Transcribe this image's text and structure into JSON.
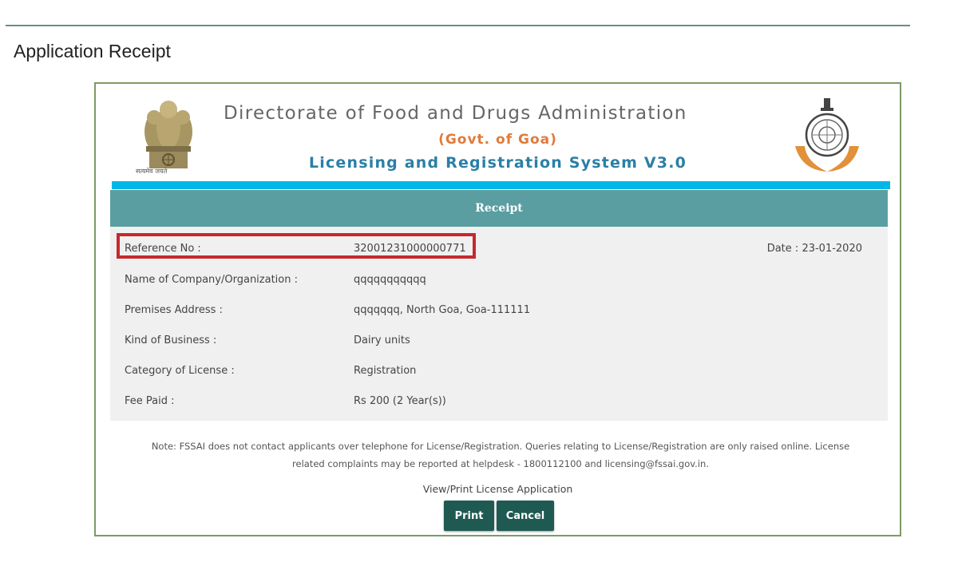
{
  "page": {
    "title": "Application Receipt"
  },
  "header": {
    "title": "Directorate of Food and Drugs Administration",
    "subtitle": "(Govt. of Goa)",
    "system": "Licensing and Registration System V3.0",
    "emblem_caption": "सत्यमेव जयते"
  },
  "receipt": {
    "banner": "Receipt",
    "reference": {
      "label": "Reference No  :",
      "value": "32001231000000771"
    },
    "date": {
      "label": "Date  :",
      "value": "23-01-2020"
    },
    "rows": [
      {
        "label": "Name of Company/Organization  :",
        "value": "qqqqqqqqqqq"
      },
      {
        "label": "Premises Address  :",
        "value": "qqqqqqq,  North Goa, Goa-111111"
      },
      {
        "label": "Kind of Business :",
        "value": "Dairy units"
      },
      {
        "label": "Category of License  :",
        "value": "Registration"
      },
      {
        "label": "Fee Paid  :",
        "value": "Rs 200 (2 Year(s))"
      }
    ]
  },
  "note": {
    "line1": "Note:  FSSAI does not contact applicants over telephone for License/Registration. Queries relating to License/Registration are only raised online. License",
    "line2": "related complaints may be reported at helpdesk - 1800112100 and licensing@fssai.gov.in."
  },
  "actions": {
    "view_print_label": "View/Print License Application",
    "print_label": "Print",
    "cancel_label": "Cancel"
  },
  "colors": {
    "banner": "#5a9ea2",
    "cyan_bar": "#00b7e8",
    "highlight": "#c4292f",
    "button": "#1e5a52",
    "orange": "#e07a3a",
    "blue": "#2b7fa6"
  }
}
